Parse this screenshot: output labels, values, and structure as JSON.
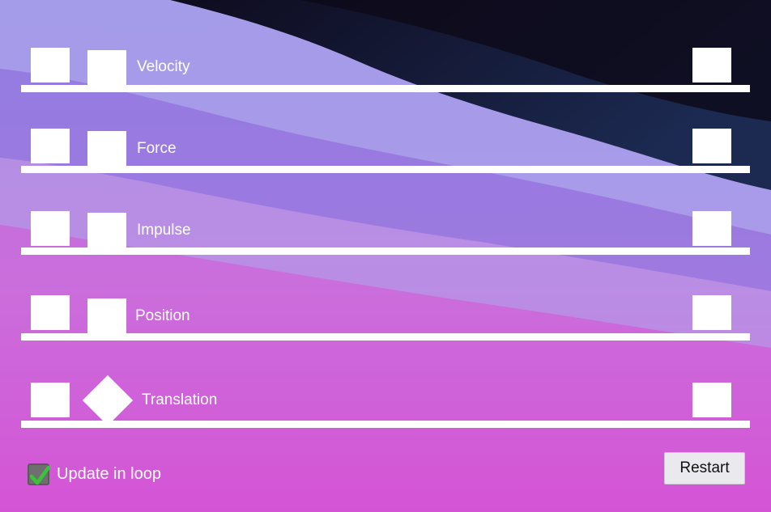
{
  "rows": [
    {
      "label": "Velocity"
    },
    {
      "label": "Force"
    },
    {
      "label": "Impulse"
    },
    {
      "label": "Position"
    },
    {
      "label": "Translation"
    }
  ],
  "controls": {
    "loop_label": "Update in loop",
    "loop_checked": true,
    "restart_label": "Restart"
  },
  "colors": {
    "checkmark": "#39c43a",
    "panel": "#ffffff"
  }
}
